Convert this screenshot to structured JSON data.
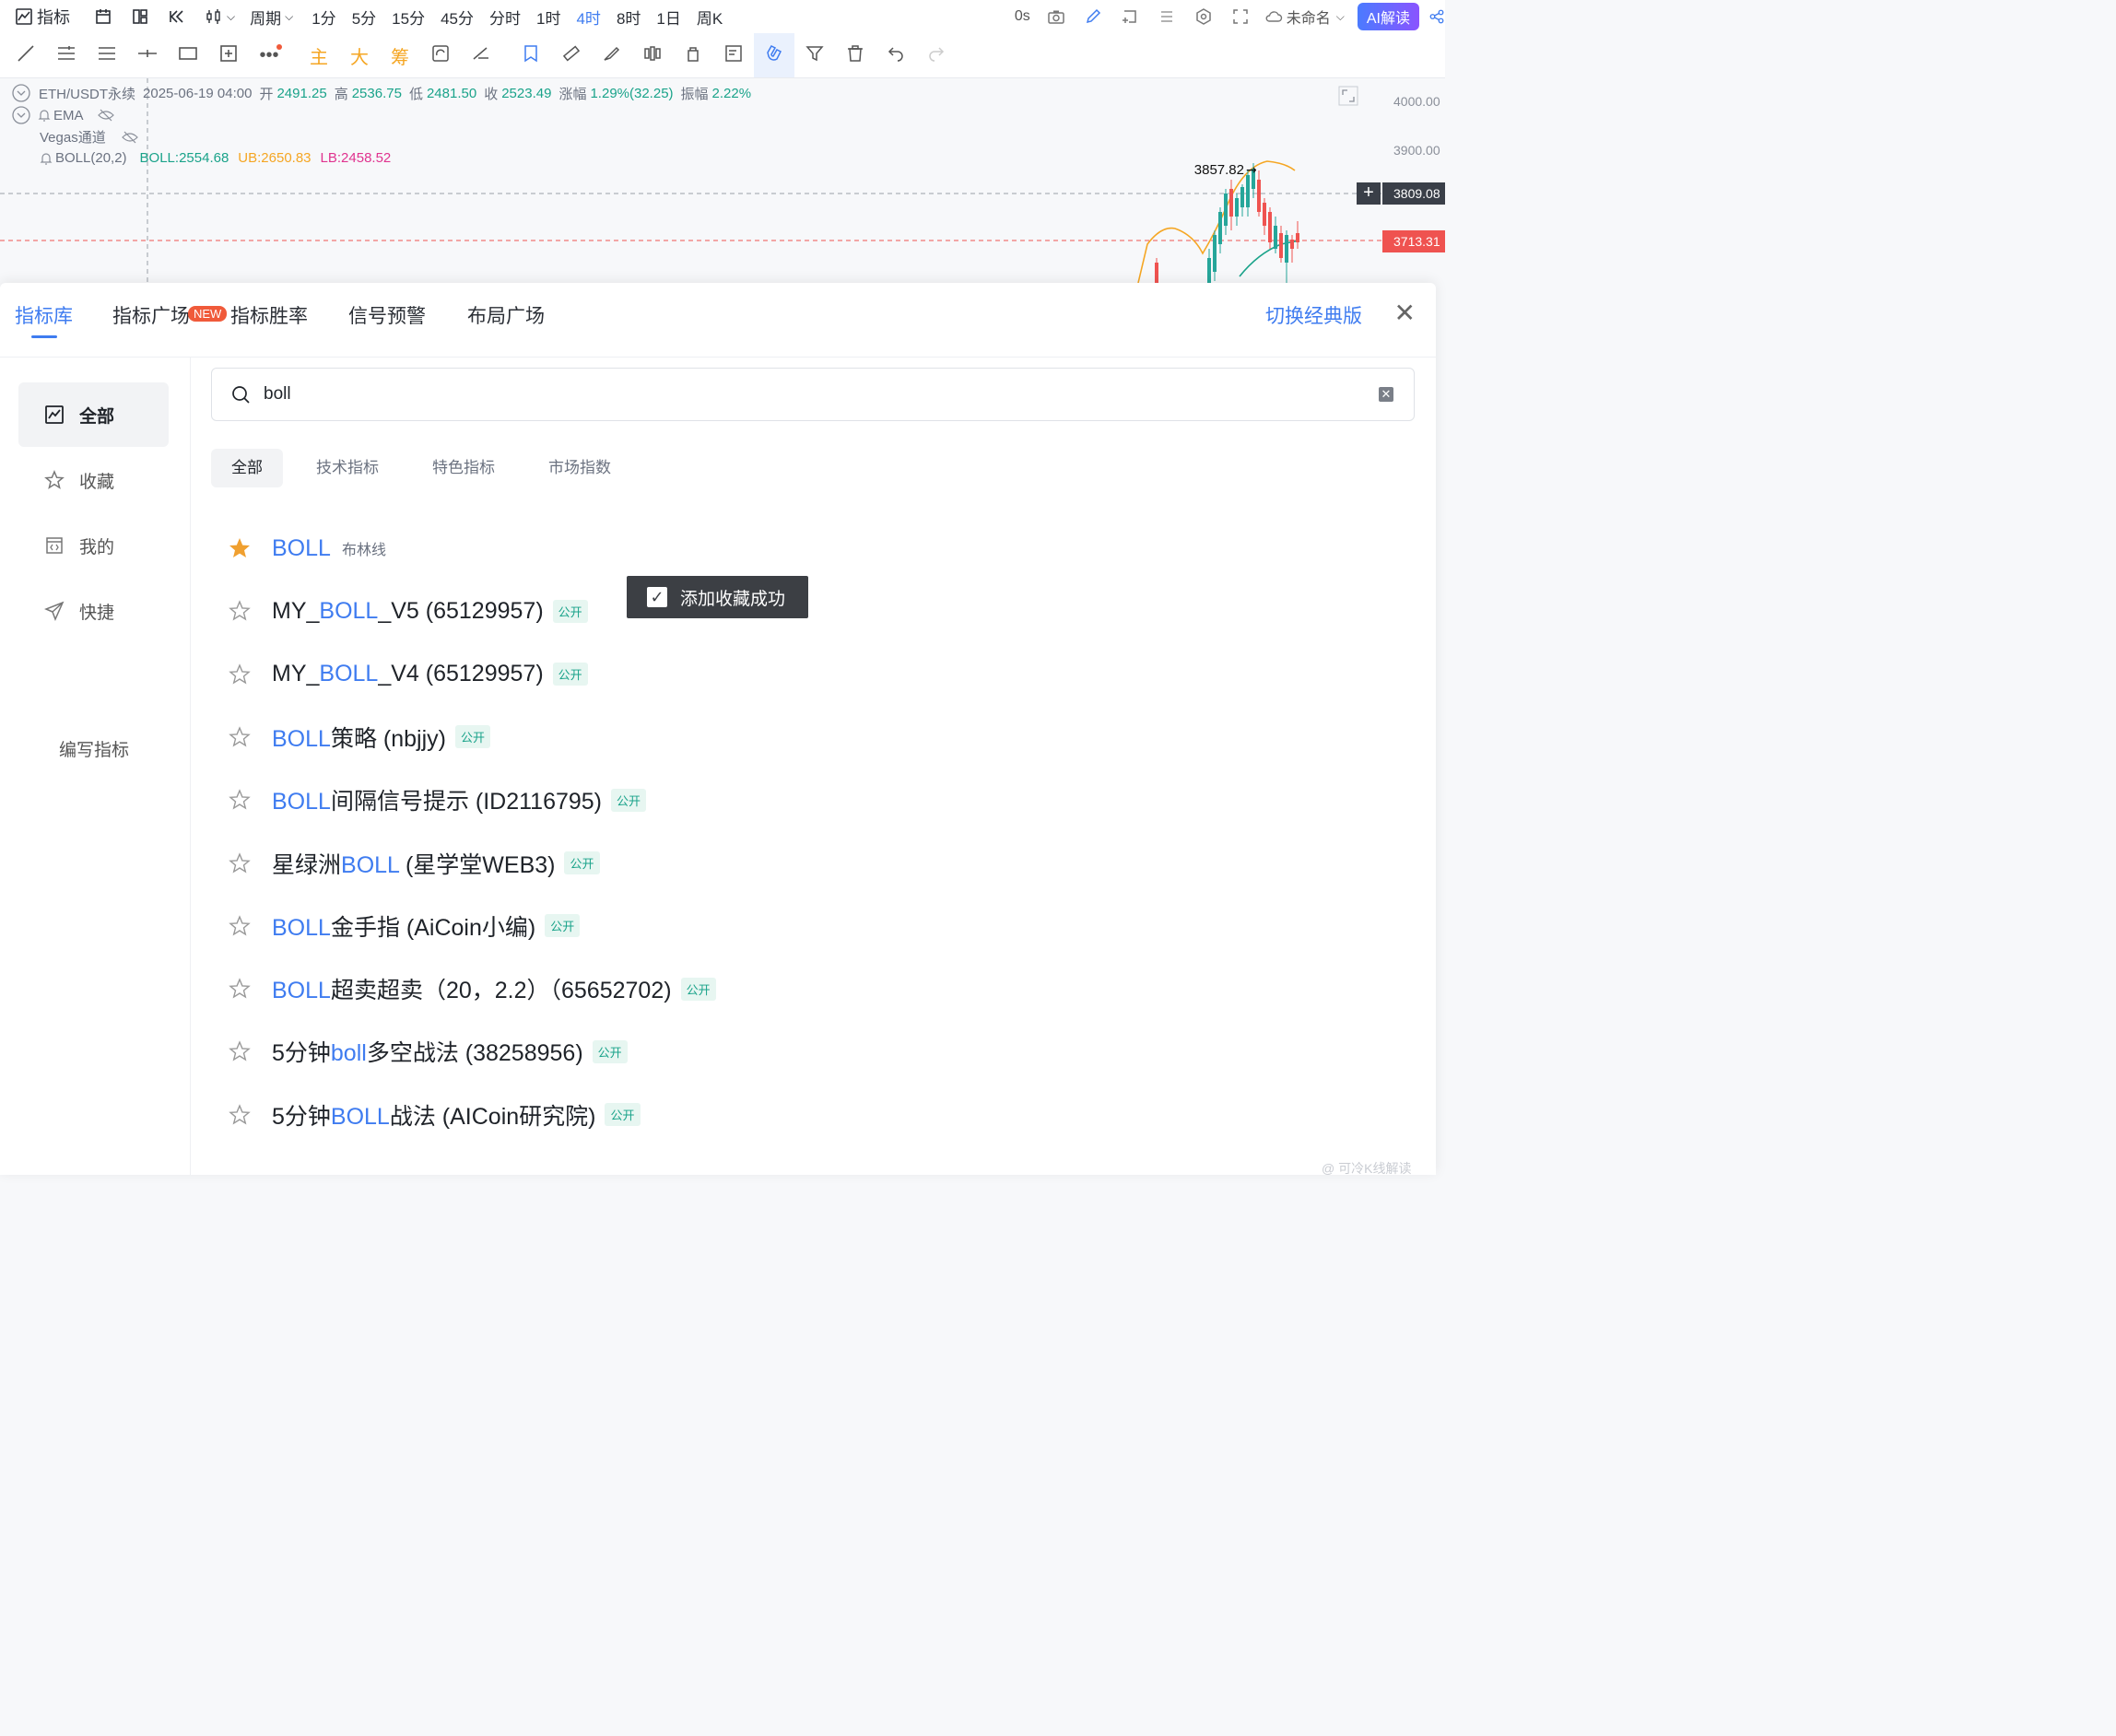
{
  "topbar": {
    "indicator_label": "指标",
    "period_label": "周期",
    "intervals": [
      "1分",
      "5分",
      "15分",
      "45分",
      "分时",
      "1时",
      "4时",
      "8时",
      "1日",
      "周K"
    ],
    "active_interval": "4时",
    "countdown": "0s",
    "workspace_name": "未命名",
    "ai_label": "AI解读"
  },
  "drawbar": {
    "main_label": "主",
    "big_label": "大",
    "chip_label": "筹"
  },
  "chart": {
    "symbol": "ETH/USDT永续",
    "datetime": "2025-06-19 04:00",
    "open_label": "开",
    "open": "2491.25",
    "high_label": "高",
    "high": "2536.75",
    "low_label": "低",
    "low": "2481.50",
    "close_label": "收",
    "close": "2523.49",
    "change_label": "涨幅",
    "change": "1.29%(32.25)",
    "amplitude_label": "振幅",
    "amplitude": "2.22%",
    "ema_label": "EMA",
    "vegas_label": "Vegas通道",
    "boll_label": "BOLL(20,2)",
    "boll_value": "BOLL:2554.68",
    "ub_value": "UB:2650.83",
    "lb_value": "LB:2458.52",
    "peak_label": "3857.82",
    "axis_prices": [
      "4000.00",
      "3900.00"
    ],
    "crosshair_price": "3809.08",
    "last_price": "3713.31",
    "colors": {
      "up": "#26a69a",
      "down": "#ef5350",
      "boll_mid": "#1aa38a",
      "ub": "#f5a623",
      "lb": "#e0338f"
    }
  },
  "modal": {
    "tabs": [
      "指标库",
      "指标广场",
      "指标胜率",
      "信号预警",
      "布局广场"
    ],
    "active_tab": "指标库",
    "new_badge": "NEW",
    "classic_label": "切换经典版",
    "sidebar": [
      "全部",
      "收藏",
      "我的",
      "快捷"
    ],
    "write_label": "编写指标",
    "search_value": "boll",
    "filters": [
      "全部",
      "技术指标",
      "特色指标",
      "市场指数"
    ],
    "public_label": "公开",
    "results": [
      {
        "pre": "",
        "hl": "BOLL",
        "post": "",
        "sub": "布林线",
        "starred": true,
        "public": false
      },
      {
        "pre": "MY_",
        "hl": "BOLL",
        "post": "_V5 (65129957)",
        "sub": "",
        "starred": false,
        "public": true
      },
      {
        "pre": "MY_",
        "hl": "BOLL",
        "post": "_V4 (65129957)",
        "sub": "",
        "starred": false,
        "public": true
      },
      {
        "pre": "",
        "hl": "BOLL",
        "post": "策略 (nbjjy)",
        "sub": "",
        "starred": false,
        "public": true
      },
      {
        "pre": "",
        "hl": "BOLL",
        "post": "间隔信号提示 (ID2116795)",
        "sub": "",
        "starred": false,
        "public": true
      },
      {
        "pre": "星绿洲",
        "hl": "BOLL",
        "post": " (星学堂WEB3)",
        "sub": "",
        "starred": false,
        "public": true
      },
      {
        "pre": "",
        "hl": "BOLL",
        "post": "金手指 (AiCoin小编)",
        "sub": "",
        "starred": false,
        "public": true
      },
      {
        "pre": "",
        "hl": "BOLL",
        "post": "超卖超卖（20，2.2）（65652702)",
        "sub": "",
        "starred": false,
        "public": true
      },
      {
        "pre": "5分钟",
        "hl": "boll",
        "post": "多空战法 (38258956)",
        "sub": "",
        "starred": false,
        "public": true
      },
      {
        "pre": "5分钟",
        "hl": "BOLL",
        "post": "战法 (AICoin研究院)",
        "sub": "",
        "starred": false,
        "public": true
      }
    ],
    "toast": "添加收藏成功"
  },
  "watermark": "@ 可冷K线解读",
  "colors": {
    "accent": "#3f7cf0",
    "star": "#f0a030",
    "public_green": "#1aa38a",
    "toast_bg": "#3c3f44"
  }
}
